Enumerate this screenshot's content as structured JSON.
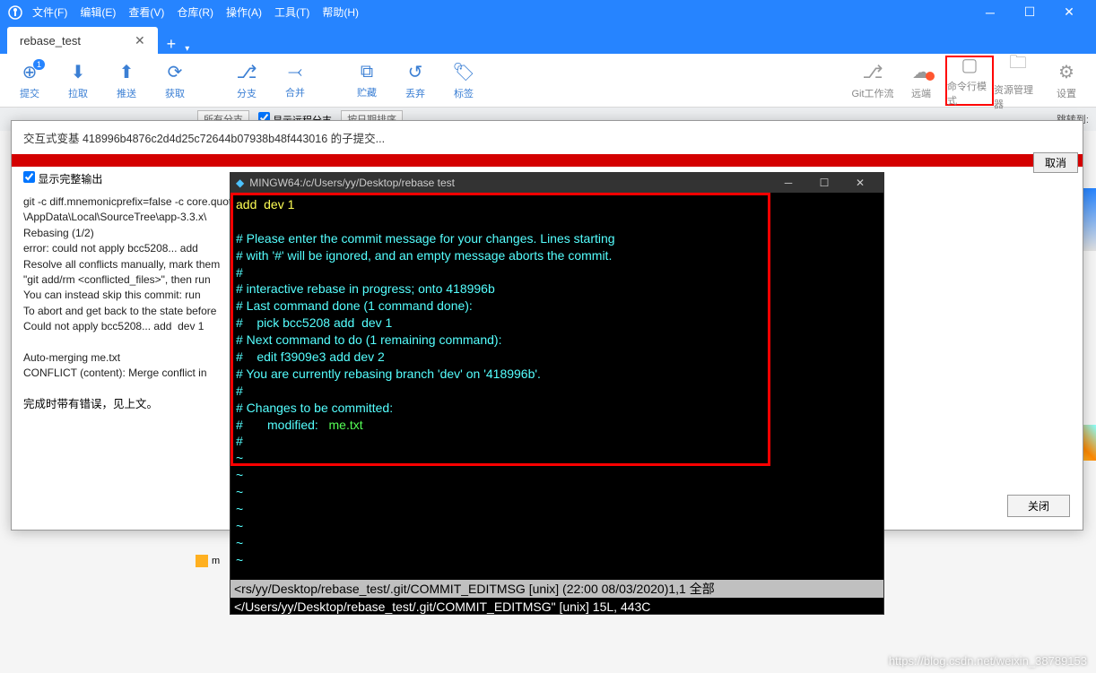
{
  "menu": {
    "items": [
      "文件(F)",
      "编辑(E)",
      "查看(V)",
      "仓库(R)",
      "操作(A)",
      "工具(T)",
      "帮助(H)"
    ]
  },
  "tab": {
    "title": "rebase_test"
  },
  "toolbar": {
    "left": [
      {
        "label": "提交",
        "icon": "⊕",
        "badge": "1"
      },
      {
        "label": "拉取",
        "icon": "⬇"
      },
      {
        "label": "推送",
        "icon": "⬆"
      },
      {
        "label": "获取",
        "icon": "⟳"
      },
      {
        "label": "分支",
        "icon": "⎇"
      },
      {
        "label": "合并",
        "icon": "⤙"
      },
      {
        "label": "贮藏",
        "icon": "⧉"
      },
      {
        "label": "丢弃",
        "icon": "↺"
      },
      {
        "label": "标签",
        "icon": "🏷"
      }
    ],
    "right": [
      {
        "label": "Git工作流",
        "icon": "⎇"
      },
      {
        "label": "远端",
        "icon": "☁",
        "warn": true
      },
      {
        "label": "命令行模式",
        "icon": "▢",
        "highlight": true
      },
      {
        "label": "资源管理器",
        "icon": "🗀"
      },
      {
        "label": "设置",
        "icon": "⚙"
      }
    ]
  },
  "filter": {
    "all_branch": "所有分支",
    "show_remote": "显示远程分支",
    "sort_date": "按日期排序",
    "jump": "跳转到:"
  },
  "modal": {
    "title": "交互式变基 418996b4876c2d4d25c72644b07938b48f443016 的子提交...",
    "show_full": "显示完整输出",
    "output_lines": [
      "git -c diff.mnemonicprefix=false -c core.quotepath=false --no-optional-locks -c core.editor='C:\\Users\\yy",
      "\\AppData\\Local\\SourceTree\\app-3.3.x\\",
      "Rebasing (1/2)",
      "error: could not apply bcc5208... add",
      "Resolve all conflicts manually, mark them",
      "\"git add/rm <conflicted_files>\", then run",
      "You can instead skip this commit: run",
      "To abort and get back to the state before",
      "Could not apply bcc5208... add  dev 1",
      "",
      "Auto-merging me.txt",
      "CONFLICT (content): Merge conflict in"
    ],
    "done_text": "完成时带有错误，见上文。",
    "close_btn": "关闭",
    "cancel_btn": "取消"
  },
  "terminal": {
    "title": "MINGW64:/c/Users/yy/Desktop/rebase test",
    "first_line": "add  dev 1",
    "comments": [
      "# Please enter the commit message for your changes. Lines starting",
      "# with '#' will be ignored, and an empty message aborts the commit.",
      "#",
      "# interactive rebase in progress; onto 418996b",
      "# Last command done (1 command done):",
      "#    pick bcc5208 add  dev 1",
      "# Next command to do (1 remaining command):",
      "#    edit f3909e3 add dev 2",
      "# You are currently rebasing branch 'dev' on '418996b'.",
      "#",
      "# Changes to be committed:"
    ],
    "modified_label": "#       modified:   ",
    "modified_file": "me.txt",
    "hash_lines": [
      "#",
      "~",
      "~",
      "~",
      "~",
      "~",
      "~",
      "~"
    ],
    "status1": "<rs/yy/Desktop/rebase_test/.git/COMMIT_EDITMSG [unix] (22:00 08/03/2020)1,1 全部",
    "status2": "</Users/yy/Desktop/rebase_test/.git/COMMIT_EDITMSG\" [unix] 15L, 443C"
  },
  "filebar": {
    "label": "m"
  },
  "watermark": "https://blog.csdn.net/weixin_38789153"
}
